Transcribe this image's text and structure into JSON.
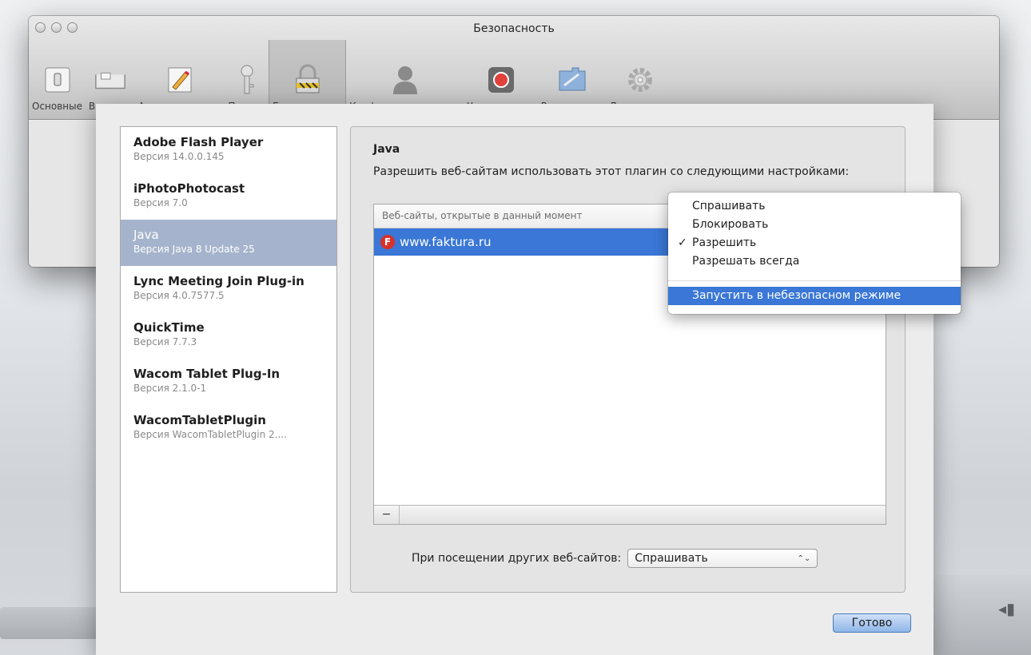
{
  "window": {
    "title": "Безопасность"
  },
  "toolbar": {
    "items": [
      {
        "label": "Основные",
        "icon": "general-switch-icon"
      },
      {
        "label": "Вкладки",
        "icon": "tabs-icon"
      },
      {
        "label": "Автозаполнение",
        "icon": "autofill-pencil-icon"
      },
      {
        "label": "Пароли",
        "icon": "key-icon"
      },
      {
        "label": "Безопасность",
        "icon": "lock-icon",
        "selected": true
      },
      {
        "label": "Конфиденциальность",
        "icon": "privacy-silhouette-icon"
      },
      {
        "label": "Уведомления",
        "icon": "notifications-icon"
      },
      {
        "label": "Расширения",
        "icon": "extensions-icon"
      },
      {
        "label": "Дополнения",
        "icon": "gear-icon"
      }
    ]
  },
  "plugins": [
    {
      "name": "Adobe Flash Player",
      "version": "Версия 14.0.0.145"
    },
    {
      "name": "iPhotoPhotocast",
      "version": "Версия 7.0"
    },
    {
      "name": "Java",
      "version": "Версия Java 8 Update 25",
      "selected": true
    },
    {
      "name": "Lync Meeting Join Plug-in",
      "version": "Версия 4.0.7577.5"
    },
    {
      "name": "QuickTime",
      "version": "Версия 7.7.3"
    },
    {
      "name": "Wacom Tablet Plug-In",
      "version": "Версия 2.1.0-1"
    },
    {
      "name": "WacomTabletPlugin",
      "version": "Версия WacomTabletPlugin 2...."
    }
  ],
  "detail": {
    "title": "Java",
    "description": "Разрешить веб-сайтам использовать этот плагин со следующими настройками:",
    "table_header": "Веб-сайты, открытые в данный момент",
    "site": "www.faktura.ru",
    "site_icon_letter": "F",
    "remove_label": "−",
    "other_sites_label": "При посещении других веб-сайтов:",
    "other_sites_value": "Спрашивать",
    "select_arrows": "⌃⌄"
  },
  "menu": {
    "items": [
      "Спрашивать",
      "Блокировать",
      "Разрешить",
      "Разрешать всегда"
    ],
    "checked_index": 2,
    "check_mark": "✓",
    "unsafe_mode": "Запустить в небезопасном режиме"
  },
  "buttons": {
    "done": "Готово",
    "help": "?"
  },
  "desktop": {
    "corner_glyph": "◂▮"
  },
  "colors": {
    "selection": "#3a77d6",
    "list_selection": "#a5b4cc",
    "default_button": "#8fb6e8"
  }
}
